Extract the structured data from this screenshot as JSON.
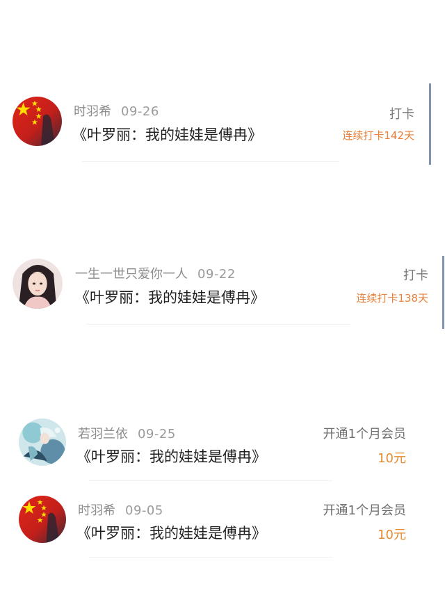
{
  "colors": {
    "accent_orange": "#e8813a",
    "price_orange": "#e38a2e",
    "edge_bar": "#8193b2",
    "flag_red": "#d8261c",
    "flag_star": "#ffde00"
  },
  "entries": [
    {
      "username": "时羽希",
      "date": "09-26",
      "book": "《叶罗丽：我的娃娃是傅冉》",
      "action": "打卡",
      "detail": "连续打卡142天",
      "avatar_icon": "china-flag-avatar-icon"
    },
    {
      "username": "一生一世只爱你一人",
      "date": "09-22",
      "book": "《叶罗丽：我的娃娃是傅冉》",
      "action": "打卡",
      "detail": "连续打卡138天",
      "avatar_icon": "portrait-avatar-icon"
    },
    {
      "username": "若羽兰依",
      "date": "09-25",
      "book": "《叶罗丽：我的娃娃是傅冉》",
      "action": "开通1个月会员",
      "detail": "10元",
      "avatar_icon": "anime-character-avatar-icon"
    },
    {
      "username": "时羽希",
      "date": "09-05",
      "book": "《叶罗丽：我的娃娃是傅冉》",
      "action": "开通1个月会员",
      "detail": "10元",
      "avatar_icon": "china-flag-avatar-icon"
    }
  ]
}
